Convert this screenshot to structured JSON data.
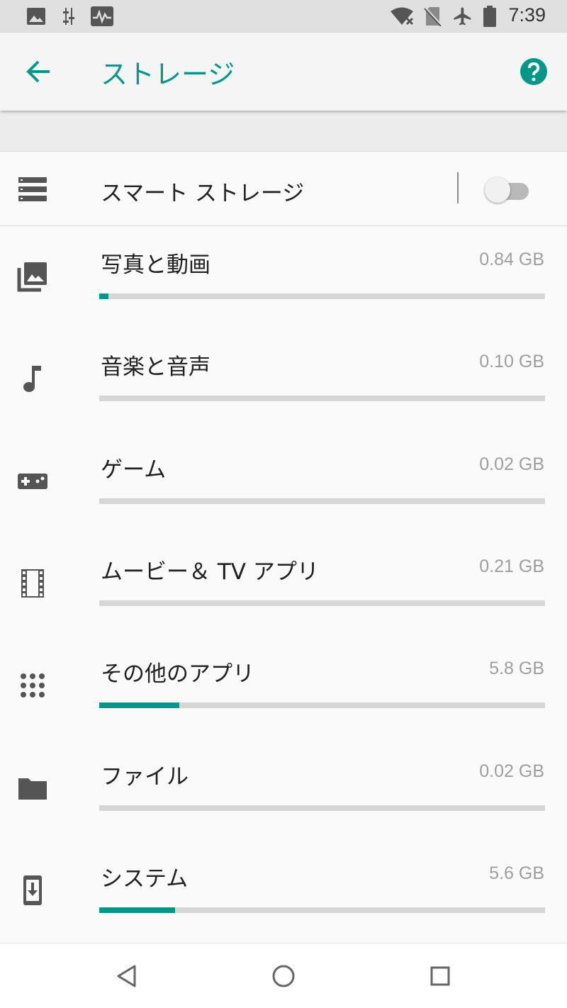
{
  "status_bar": {
    "time": "7:39",
    "left_icons": [
      "image-notification-icon",
      "equalizer-notification-icon",
      "activity-notification-icon"
    ],
    "right_icons": [
      "wifi-off-icon",
      "no-sim-icon",
      "airplane-mode-icon",
      "battery-icon"
    ]
  },
  "app_bar": {
    "title": "ストレージ",
    "back_icon": "arrow-back-icon",
    "help_icon": "help-circle-icon",
    "accent_color": "#009688"
  },
  "smart_storage": {
    "label": "スマート ストレージ",
    "icon": "storage-icon",
    "toggle_on": false
  },
  "categories": [
    {
      "label": "写真と動画",
      "size": "0.84 GB",
      "icon": "photo-library-icon",
      "fill": 0.02
    },
    {
      "label": "音楽と音声",
      "size": "0.10 GB",
      "icon": "music-note-icon",
      "fill": 0.0
    },
    {
      "label": "ゲーム",
      "size": "0.02 GB",
      "icon": "gamepad-icon",
      "fill": 0.0
    },
    {
      "label": "ムービー＆ TV アプリ",
      "size": "0.21 GB",
      "icon": "movie-icon",
      "fill": 0.0
    },
    {
      "label": "その他のアプリ",
      "size": "5.8 GB",
      "icon": "apps-icon",
      "fill": 0.18
    },
    {
      "label": "ファイル",
      "size": "0.02 GB",
      "icon": "folder-icon",
      "fill": 0.0
    },
    {
      "label": "システム",
      "size": "5.6 GB",
      "icon": "system-update-icon",
      "fill": 0.17
    }
  ],
  "nav_bar": {
    "buttons": [
      "back-triangle-icon",
      "home-circle-icon",
      "recents-square-icon"
    ]
  }
}
